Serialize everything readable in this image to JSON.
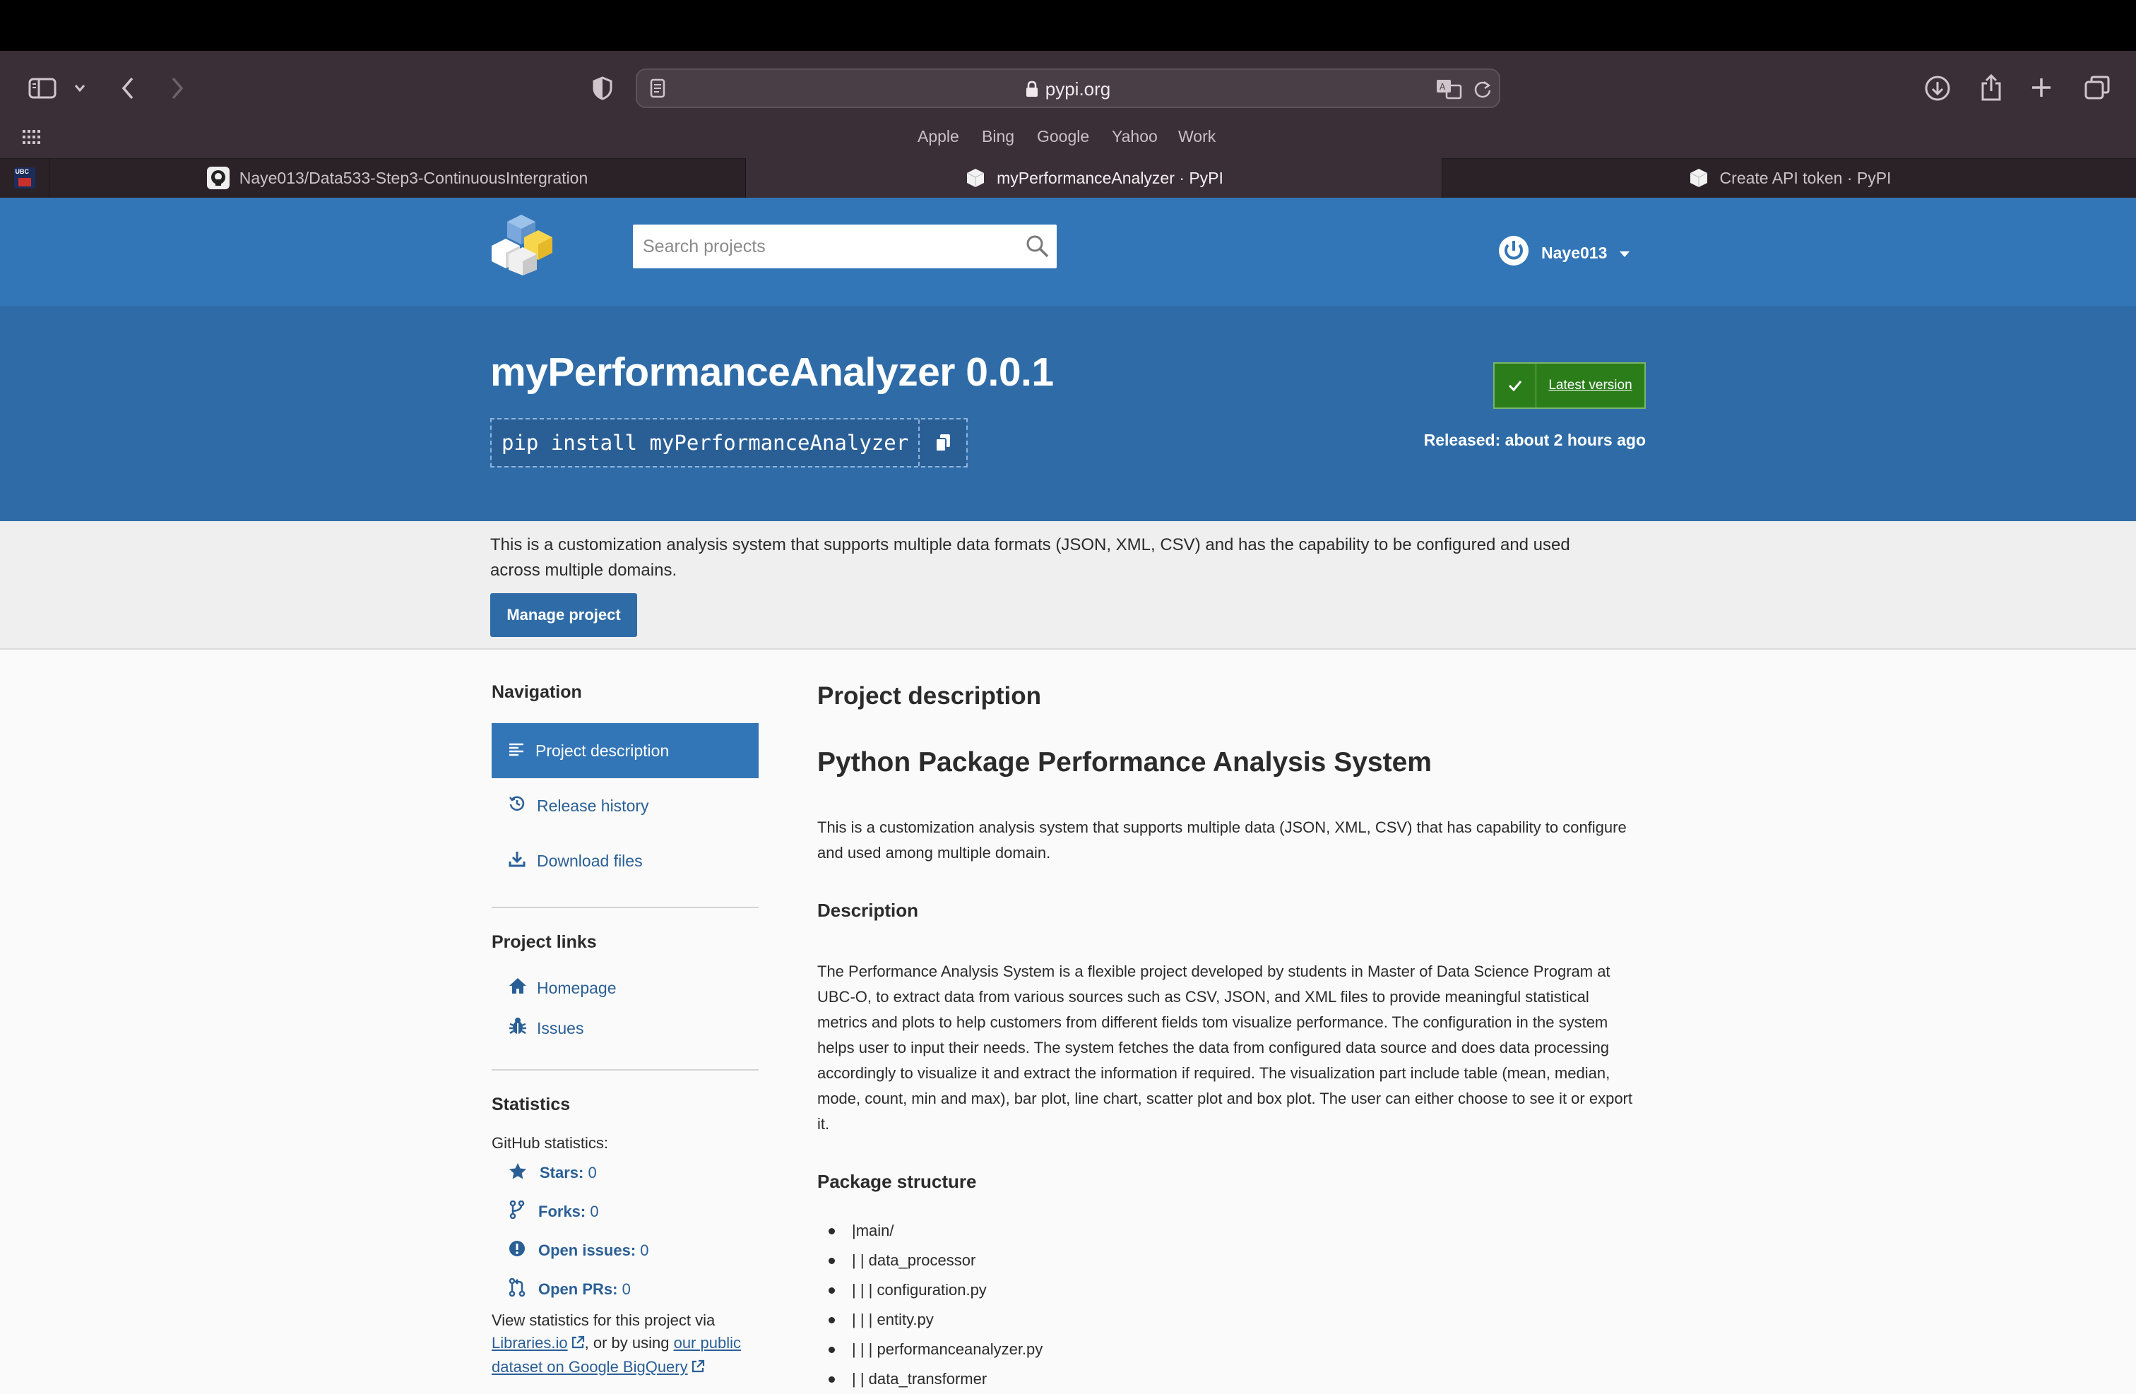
{
  "browser": {
    "url": "pypi.org",
    "favorites": [
      "Apple",
      "Bing",
      "Google",
      "Yahoo",
      "Work"
    ],
    "tabs": [
      {
        "label": "Naye013/Data533-Step3-ContinuousIntergration",
        "icon": "github-icon"
      },
      {
        "label": "myPerformanceAnalyzer · PyPI",
        "icon": "pypi-cube-icon"
      },
      {
        "label": "Create API token · PyPI",
        "icon": "pypi-cube-icon"
      }
    ],
    "pinned_tab": "UBC"
  },
  "header": {
    "search_placeholder": "Search projects",
    "username": "Naye013"
  },
  "package": {
    "title": "myPerformanceAnalyzer 0.0.1",
    "pip_command": "pip install myPerformanceAnalyzer",
    "latest_label": "Latest version",
    "released": "Released: about 2 hours ago",
    "summary": "This is a customization analysis system that supports multiple data formats (JSON, XML, CSV) and has the capability to be configured and used across multiple domains.",
    "manage_label": "Manage project"
  },
  "sidebar": {
    "navigation_heading": "Navigation",
    "nav": [
      "Project description",
      "Release history",
      "Download files"
    ],
    "links_heading": "Project links",
    "links": [
      "Homepage",
      "Issues"
    ],
    "statistics_heading": "Statistics",
    "github_stats_label": "GitHub statistics:",
    "stats": [
      {
        "label": "Stars:",
        "value": "0"
      },
      {
        "label": "Forks:",
        "value": "0"
      },
      {
        "label": "Open issues:",
        "value": "0"
      },
      {
        "label": "Open PRs:",
        "value": "0"
      }
    ],
    "view_stats_prefix": "View statistics for this project via",
    "libraries_link": "Libraries.io",
    "view_stats_mid": ", or by using",
    "bigquery_link": "our public dataset on Google BigQuery"
  },
  "main": {
    "project_description_heading": "Project description",
    "readme_title": "Python Package Performance Analysis System",
    "intro": "This is a customization analysis system that supports multiple data (JSON, XML, CSV) that has capability to configure and used among multiple domain.",
    "description_heading": "Description",
    "description": "The Performance Analysis System is a flexible project developed by students in Master of Data Science Program at UBC-O, to extract data from various sources such as CSV, JSON, and XML files to provide meaningful statistical metrics and plots to help customers from different fields tom visualize performance. The configuration in the system helps user to input their needs. The system fetches the data from configured data source and does data processing accordingly to visualize it and extract the information if required. The visualization part include table (mean, median, mode, count, min and max), bar plot, line chart, scatter plot and box plot. The user can either choose to see it or export it.",
    "structure_heading": "Package structure",
    "structure": [
      "|main/",
      "| | data_processor",
      "| | | configuration.py",
      "| | | entity.py",
      "| | | performanceanalyzer.py",
      "| | data_transformer"
    ]
  }
}
